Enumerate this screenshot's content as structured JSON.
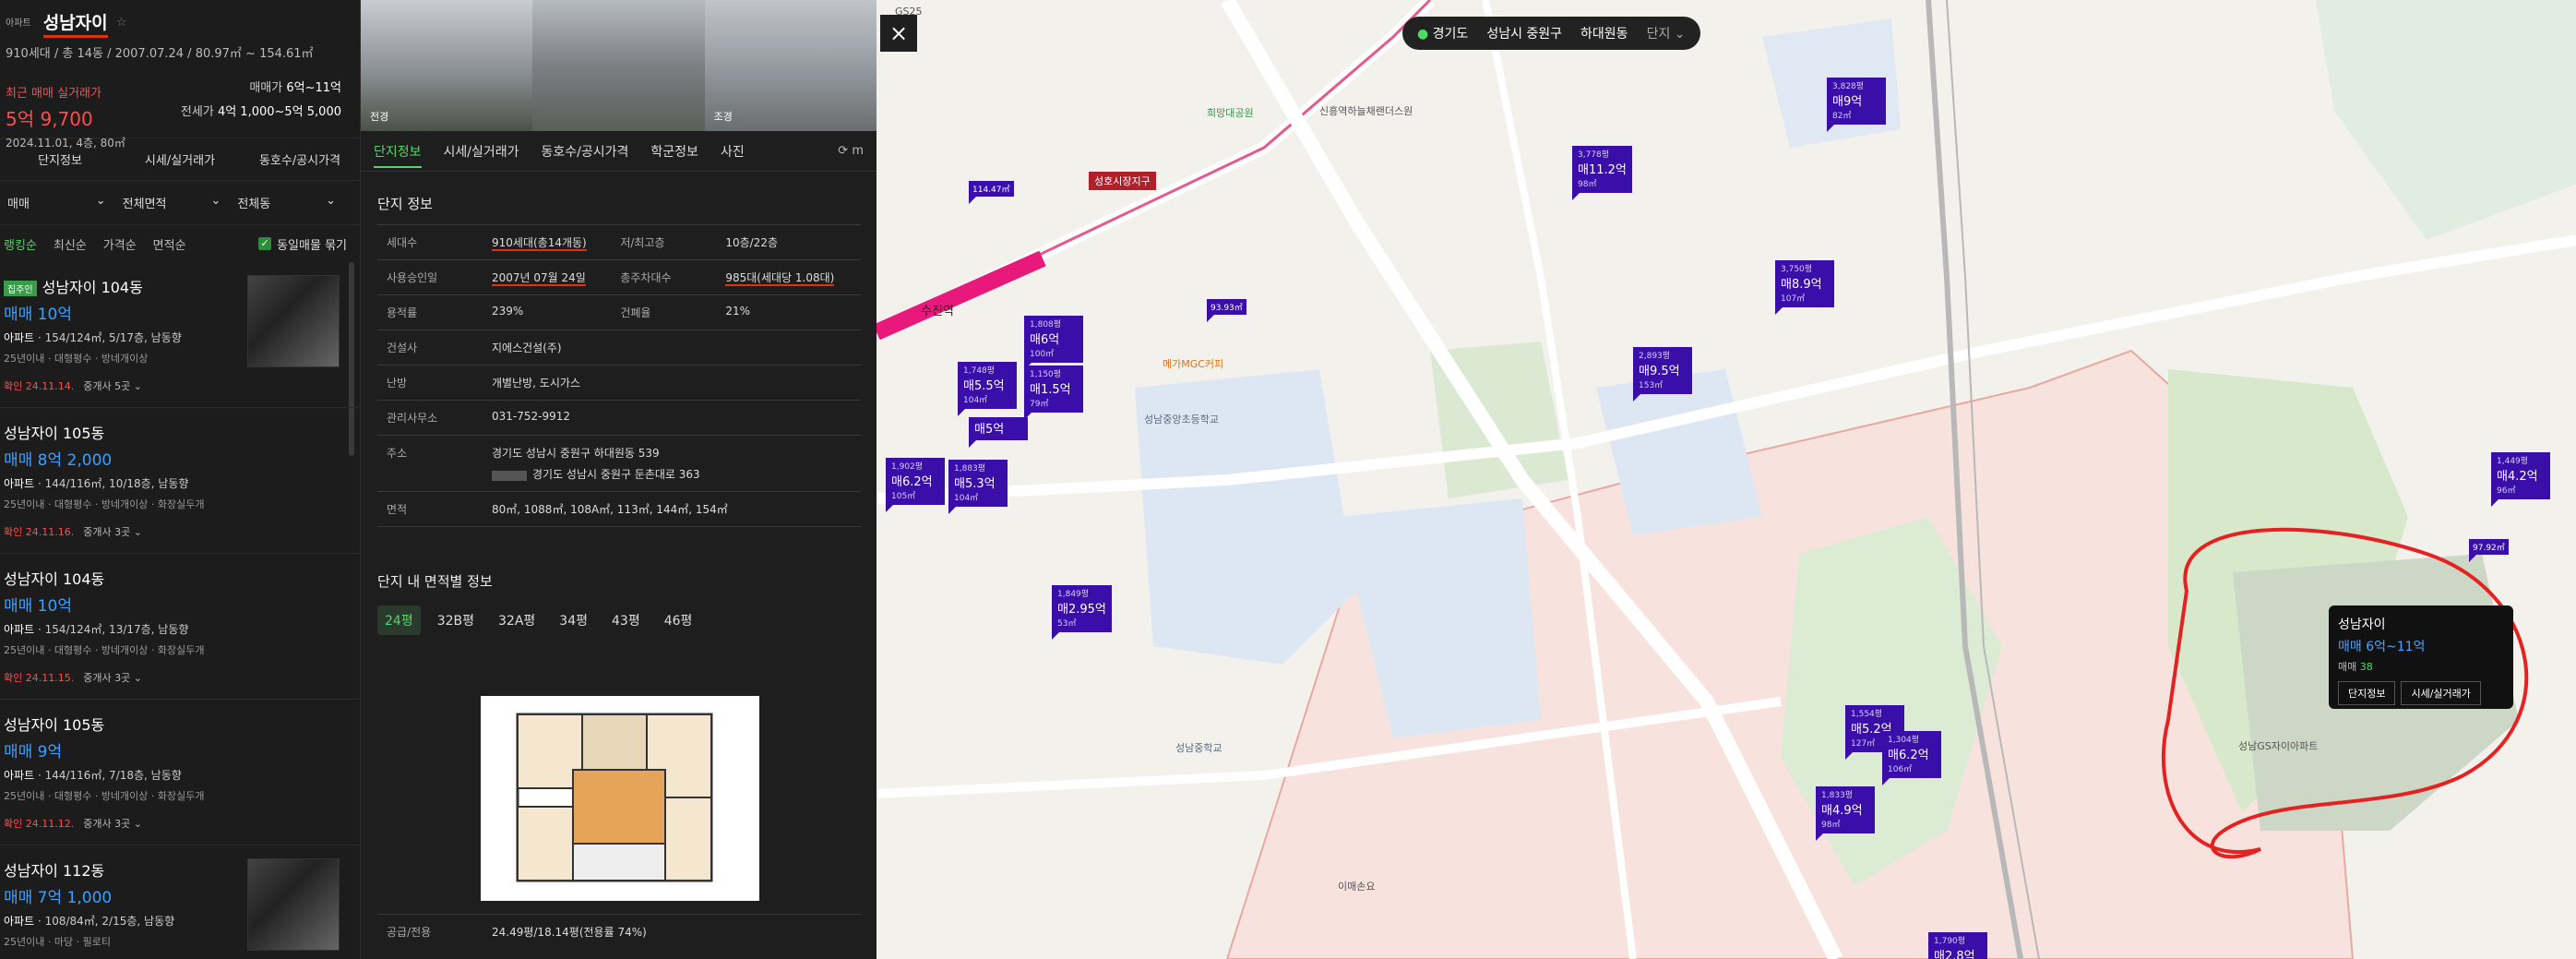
{
  "apt": {
    "tag": "아파트",
    "name": "성남자이",
    "info": "910세대 / 총 14동 / 2007.07.24 / 80.97㎡ ~ 154.61㎡",
    "recent_label": "최근 매매 실거래가",
    "recent_price": "5억 9,700",
    "recent_date": "2024.11.01, 4층, 80㎡",
    "sale_label": "매매가",
    "sale_value": "6억~11억",
    "jeonse_label": "전세가",
    "jeonse_value": "4억 1,000~5억 5,000"
  },
  "subtabs": [
    "단지정보",
    "시세/실거래가",
    "동호수/공시가격"
  ],
  "filters": [
    "매매",
    "전체면적",
    "전체동"
  ],
  "sorts": [
    "랭킹순",
    "최신순",
    "가격순",
    "면적순"
  ],
  "same_listing": "동일매물 묶기",
  "listings": [
    {
      "badge": "집주인",
      "title": "성남자이 104동",
      "price": "매매 10억",
      "spec_type": "아파트",
      "spec": "154/124㎡, 5/17층, 남동향",
      "desc": "25년이내 · 대형평수 · 방네개이상",
      "date": "확인 24.11.14.",
      "agent": "중개사 5곳"
    },
    {
      "badge": "",
      "title": "성남자이 105동",
      "price": "매매 8억 2,000",
      "spec_type": "아파트",
      "spec": "144/116㎡, 10/18층, 남동향",
      "desc": "25년이내 · 대형평수 · 방네개이상 · 화장실두개",
      "date": "확인 24.11.16.",
      "agent": "중개사 3곳"
    },
    {
      "badge": "",
      "title": "성남자이 104동",
      "price": "매매 10억",
      "spec_type": "아파트",
      "spec": "154/124㎡, 13/17층, 남동향",
      "desc": "25년이내 · 대형평수 · 방네개이상 · 화장실두개",
      "date": "확인 24.11.15.",
      "agent": "중개사 3곳"
    },
    {
      "badge": "",
      "title": "성남자이 105동",
      "price": "매매 9억",
      "spec_type": "아파트",
      "spec": "144/116㎡, 7/18층, 남동향",
      "desc": "25년이내 · 대형평수 · 방네개이상 · 화장실두개",
      "date": "확인 24.11.12.",
      "agent": "중개사 3곳"
    },
    {
      "badge": "",
      "title": "성남자이 112동",
      "price": "매매 7억 1,000",
      "spec_type": "아파트",
      "spec": "108/84㎡, 2/15층, 남동향",
      "desc": "25년이내 · 마당 · 필로티",
      "date": "",
      "agent": ""
    }
  ],
  "photos": [
    "전경",
    "",
    "조경"
  ],
  "detail_tabs": [
    "단지정보",
    "시세/실거래가",
    "동호수/공시가격",
    "학군정보",
    "사진"
  ],
  "detail_title": "단지 정보",
  "info_rows": [
    {
      "k1": "세대수",
      "v1": "910세대(총14개동)",
      "k2": "저/최고층",
      "v2": "10층/22층"
    },
    {
      "k1": "사용승인일",
      "v1": "2007년 07월 24일",
      "k2": "총주차대수",
      "v2": "985대(세대당 1.08대)"
    },
    {
      "k1": "용적률",
      "v1": "239%",
      "k2": "건폐율",
      "v2": "21%"
    },
    {
      "k1": "건설사",
      "v1": "지에스건설(주)",
      "k2": "",
      "v2": ""
    },
    {
      "k1": "난방",
      "v1": "개별난방, 도시가스",
      "k2": "",
      "v2": ""
    },
    {
      "k1": "관리사무소",
      "v1": "031-752-9912",
      "k2": "",
      "v2": ""
    },
    {
      "k1": "주소",
      "v1": "경기도 성남시 중원구 하대원동 539",
      "k2": "",
      "v2": "",
      "v1b": "경기도 성남시 중원구 둔촌대로 363"
    },
    {
      "k1": "면적",
      "v1": "80㎡, 1088㎡, 108A㎡, 113㎡, 144㎡, 154㎡",
      "k2": "",
      "v2": ""
    }
  ],
  "area_title": "단지 내 면적별 정보",
  "area_tabs": [
    "24평",
    "32B평",
    "32A평",
    "34평",
    "43평",
    "46평"
  ],
  "supply_label": "공급/전용",
  "supply_value": "24.49평/18.14평(전용률 74%)",
  "breadcrumb": {
    "region": "경기도",
    "city": "성남시 중원구",
    "dong": "하대원동",
    "type": "단지"
  },
  "map_markers": [
    {
      "top": "3,828평",
      "price": "매9억",
      "sub": "82㎡"
    },
    {
      "top": "3,778평",
      "price": "매11.2억",
      "sub": "98㎡"
    },
    {
      "top": "3,750평",
      "price": "매8.9억",
      "sub": "107㎡"
    },
    {
      "top": "2,893평",
      "price": "매9.5억",
      "sub": "153㎡"
    },
    {
      "top": "1,808평",
      "price": "매6억",
      "sub": "100㎡"
    },
    {
      "top": "1,748평",
      "price": "매5.5억",
      "sub": "104㎡"
    },
    {
      "top": "1,150평",
      "price": "매1.5억",
      "sub": "79㎡"
    },
    {
      "top": "",
      "price": "매5억",
      "sub": ""
    },
    {
      "top": "1,902평",
      "price": "매6.2억",
      "sub": "105㎡"
    },
    {
      "top": "1,883평",
      "price": "매5.3억",
      "sub": "104㎡"
    },
    {
      "top": "1,849평",
      "price": "매2.95억",
      "sub": "53㎡"
    },
    {
      "top": "1,554평",
      "price": "매5.2억",
      "sub": "127㎡"
    },
    {
      "top": "1,304평",
      "price": "매6.2억",
      "sub": "106㎡"
    },
    {
      "top": "1,833평",
      "price": "매4.9억",
      "sub": "98㎡"
    },
    {
      "top": "1,449평",
      "price": "매4.2억",
      "sub": "96㎡"
    },
    {
      "top": "1,790평",
      "price": "매2.8억",
      "sub": ""
    }
  ],
  "small_markers": [
    "114.47㎡",
    "93.93㎡",
    "97.92㎡"
  ],
  "map_labels": {
    "station": "수진역",
    "zone": "성호시장지구",
    "school1": "성남중앙초등학교",
    "school2": "성남중학교",
    "park": "희망대공원",
    "apt2": "신흥역하늘채랜더스원",
    "popup_area": "성남GS자이아파트",
    "cafe": "메가MGC커피",
    "store1": "GS25",
    "hospital": "이매손요"
  },
  "popup": {
    "name": "성남자이",
    "price": "매매 6억~11억",
    "count_label": "매매",
    "count": "38",
    "btn1": "단지정보",
    "btn2": "시세/실거래가"
  },
  "colors": {
    "accent_green": "#4cd964",
    "marker": "#3a0ea8",
    "price_blue": "#3aa0ff",
    "warn_red": "#ff4d4d"
  }
}
